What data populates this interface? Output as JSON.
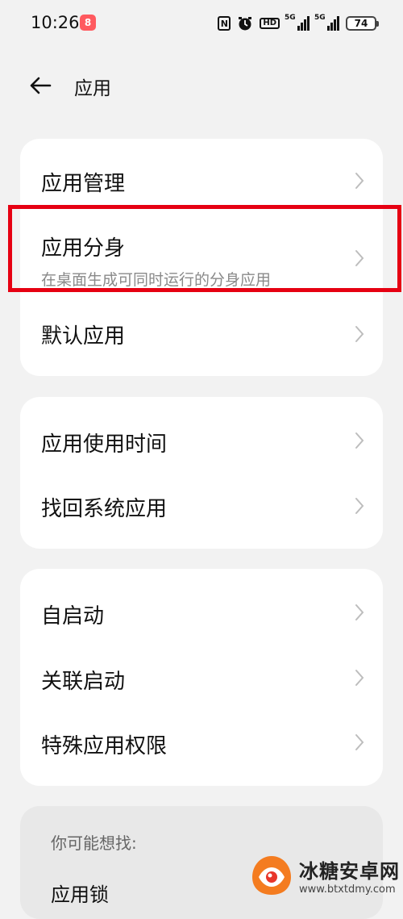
{
  "status_bar": {
    "time": "10:26",
    "app_badge": "8",
    "nfc": "N",
    "hd": "HD",
    "signal1_label": "5G",
    "signal2_label": "5G",
    "battery": "74"
  },
  "header": {
    "title": "应用"
  },
  "groups": [
    {
      "items": [
        {
          "label": "应用管理"
        },
        {
          "label": "应用分身",
          "subtitle": "在桌面生成可同时运行的分身应用"
        },
        {
          "label": "默认应用"
        }
      ]
    },
    {
      "items": [
        {
          "label": "应用使用时间"
        },
        {
          "label": "找回系统应用"
        }
      ]
    },
    {
      "items": [
        {
          "label": "自启动"
        },
        {
          "label": "关联启动"
        },
        {
          "label": "特殊应用权限"
        }
      ]
    }
  ],
  "suggestions": {
    "title": "你可能想找:",
    "items": [
      "应用锁"
    ]
  },
  "watermark": {
    "name": "冰糖安卓网",
    "url": "www.btxtdmy.com"
  },
  "colors": {
    "background": "#f2f2f2",
    "card": "#ffffff",
    "highlight_border": "#e60012",
    "subtitle": "#8a8a8a"
  }
}
